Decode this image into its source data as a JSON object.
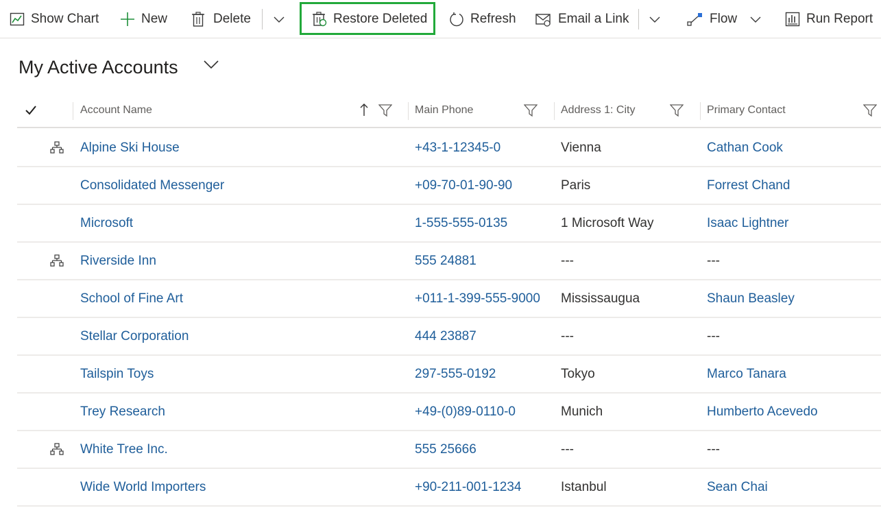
{
  "toolbar": {
    "show_chart": "Show Chart",
    "new": "New",
    "delete": "Delete",
    "restore_deleted": "Restore Deleted",
    "refresh": "Refresh",
    "email_link": "Email a Link",
    "flow": "Flow",
    "run_report": "Run Report",
    "highlight_color": "#22a93a"
  },
  "view": {
    "title": "My Active Accounts"
  },
  "columns": {
    "account_name": "Account Name",
    "main_phone": "Main Phone",
    "city": "Address 1: City",
    "primary_contact": "Primary Contact",
    "sort": "ascending"
  },
  "rows": [
    {
      "hierarchy": true,
      "name": "Alpine Ski House",
      "phone": "+43-1-12345-0",
      "city": "Vienna",
      "contact": "Cathan Cook"
    },
    {
      "hierarchy": false,
      "name": "Consolidated Messenger",
      "phone": "+09-70-01-90-90",
      "city": "Paris",
      "contact": "Forrest Chand"
    },
    {
      "hierarchy": false,
      "name": "Microsoft",
      "phone": "1-555-555-0135",
      "city": "1 Microsoft Way",
      "contact": "Isaac Lightner"
    },
    {
      "hierarchy": true,
      "name": "Riverside Inn",
      "phone": "555 24881",
      "city": "---",
      "contact": "---"
    },
    {
      "hierarchy": false,
      "name": "School of Fine Art",
      "phone": "+011-1-399-555-9000",
      "city": "Mississaugua",
      "contact": "Shaun Beasley"
    },
    {
      "hierarchy": false,
      "name": "Stellar Corporation",
      "phone": "444 23887",
      "city": "---",
      "contact": "---"
    },
    {
      "hierarchy": false,
      "name": "Tailspin Toys",
      "phone": "297-555-0192",
      "city": "Tokyo",
      "contact": "Marco Tanara"
    },
    {
      "hierarchy": false,
      "name": "Trey Research",
      "phone": "+49-(0)89-0110-0",
      "city": "Munich",
      "contact": "Humberto Acevedo"
    },
    {
      "hierarchy": true,
      "name": "White Tree Inc.",
      "phone": "555 25666",
      "city": "---",
      "contact": "---"
    },
    {
      "hierarchy": false,
      "name": "Wide World Importers",
      "phone": "+90-211-001-1234",
      "city": "Istanbul",
      "contact": "Sean Chai"
    }
  ],
  "colors": {
    "link": "#1f5e9a",
    "text": "#323130",
    "header_text": "#605e5c"
  }
}
